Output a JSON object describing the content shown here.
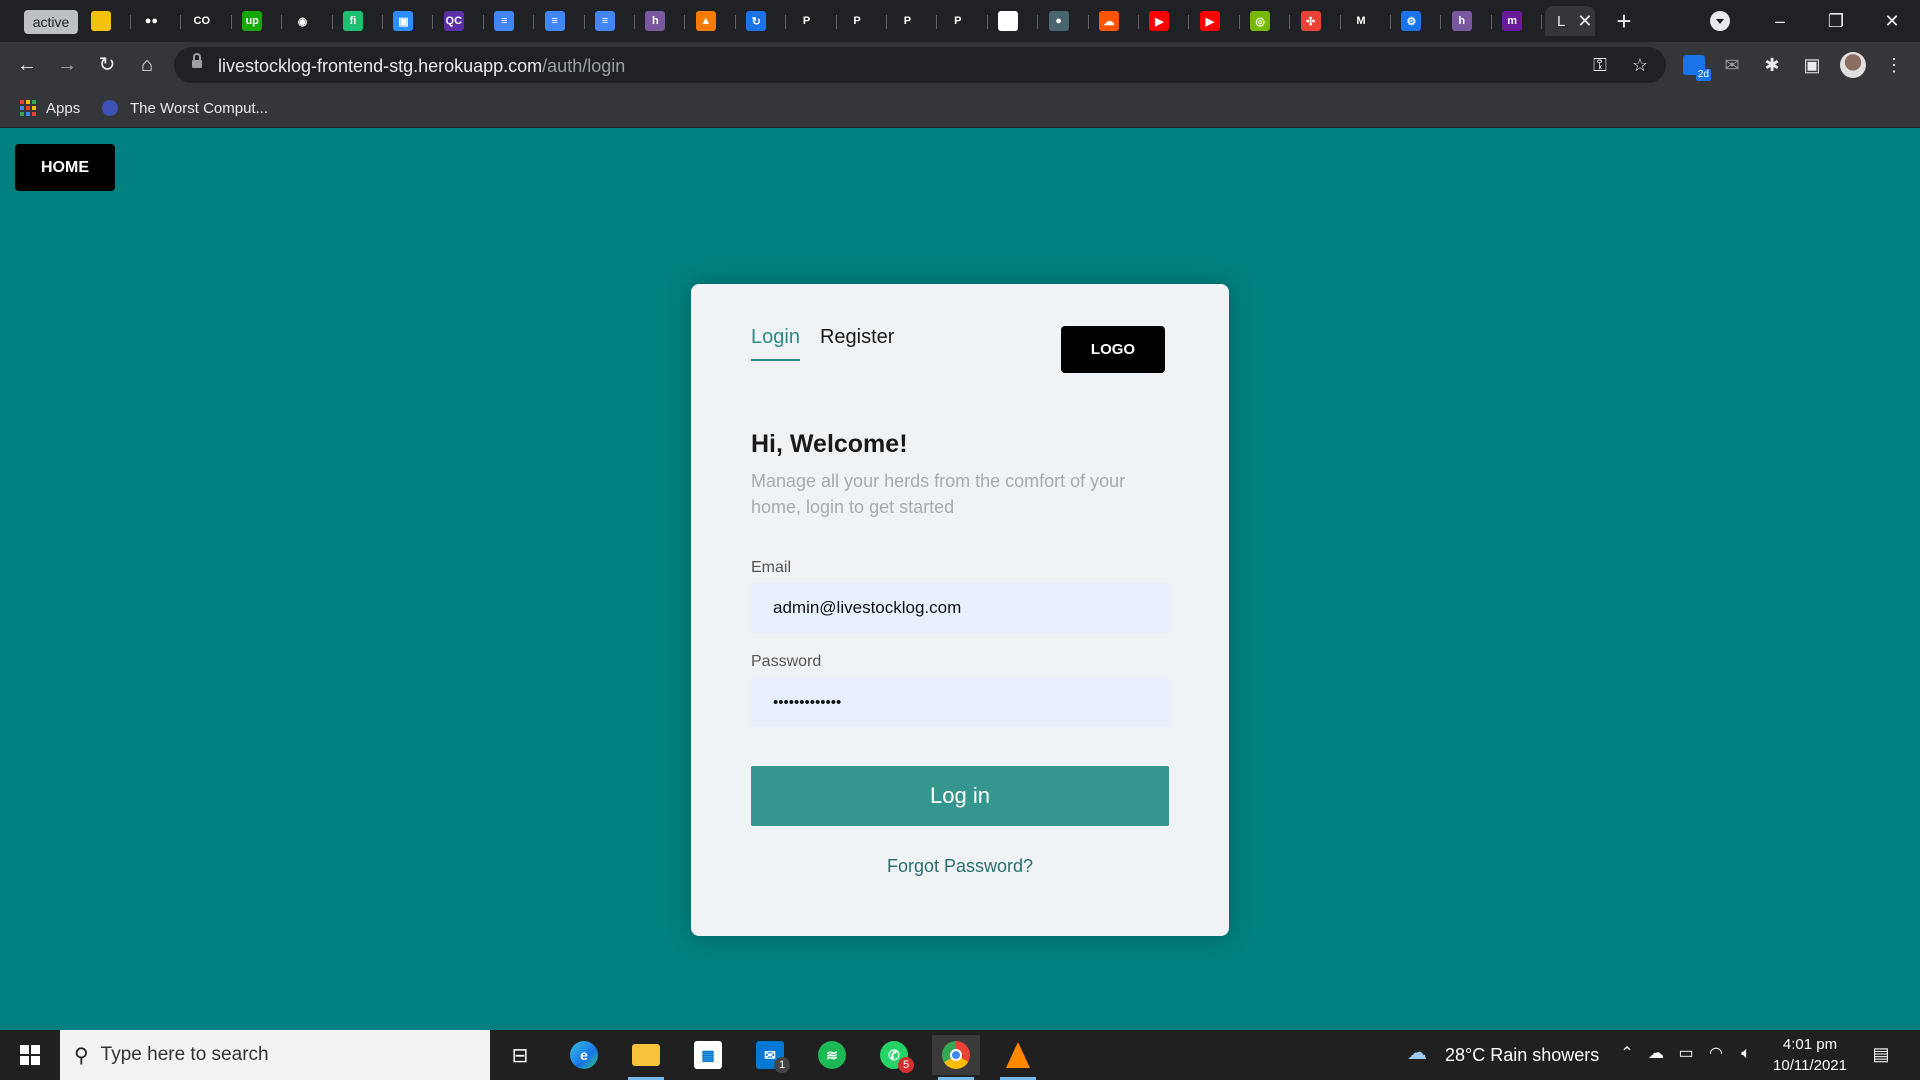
{
  "browser": {
    "active_tab_label": "active",
    "current_tab_title": "L",
    "tabs": [
      {
        "icon": "fhn-news-icon",
        "glyph": "",
        "color": "#f4c20d"
      },
      {
        "icon": "medium-icon",
        "glyph": "●●",
        "color": "#202124"
      },
      {
        "icon": "codepen-icon",
        "glyph": "CO",
        "color": "#202124"
      },
      {
        "icon": "upwork-icon",
        "glyph": "up",
        "color": "#14a800"
      },
      {
        "icon": "github-icon",
        "glyph": "◉",
        "color": "#202124"
      },
      {
        "icon": "fiverr-icon",
        "glyph": "fi",
        "color": "#1dbf73"
      },
      {
        "icon": "zoom-icon",
        "glyph": "▣",
        "color": "#2d8cff"
      },
      {
        "icon": "qc-icon",
        "glyph": "QC",
        "color": "#5b2ea6"
      },
      {
        "icon": "google-docs-icon",
        "glyph": "≡",
        "color": "#4285f4"
      },
      {
        "icon": "google-docs-icon",
        "glyph": "≡",
        "color": "#4285f4"
      },
      {
        "icon": "google-docs-icon",
        "glyph": "≡",
        "color": "#4285f4"
      },
      {
        "icon": "heroku-icon",
        "glyph": "h",
        "color": "#79589f"
      },
      {
        "icon": "orange-app-icon",
        "glyph": "▲",
        "color": "#f57c00"
      },
      {
        "icon": "refresh-app-icon",
        "glyph": "↻",
        "color": "#1a73e8"
      },
      {
        "icon": "paypal-icon",
        "glyph": "P",
        "color": "#202124"
      },
      {
        "icon": "paypal-icon",
        "glyph": "P",
        "color": "#202124"
      },
      {
        "icon": "paypal-icon",
        "glyph": "P",
        "color": "#202124"
      },
      {
        "icon": "paypal-icon",
        "glyph": "P",
        "color": "#202124"
      },
      {
        "icon": "play-icon",
        "glyph": "▶",
        "color": "#ffffff"
      },
      {
        "icon": "globe-icon",
        "glyph": "●",
        "color": "#4a6572"
      },
      {
        "icon": "soundcloud-icon",
        "glyph": "☁",
        "color": "#ff5500"
      },
      {
        "icon": "youtube-icon",
        "glyph": "▶",
        "color": "#ff0000"
      },
      {
        "icon": "youtube-icon",
        "glyph": "▶",
        "color": "#ff0000"
      },
      {
        "icon": "nvidia-icon",
        "glyph": "◎",
        "color": "#76b900"
      },
      {
        "icon": "pinwheel-icon",
        "glyph": "✣",
        "color": "#ea4335"
      },
      {
        "icon": "gmail-icon",
        "glyph": "M",
        "color": "#202124"
      },
      {
        "icon": "settings-icon",
        "glyph": "⚙",
        "color": "#1a73e8"
      },
      {
        "icon": "heroku-icon",
        "glyph": "h",
        "color": "#79589f"
      },
      {
        "icon": "m-app-icon",
        "glyph": "m",
        "color": "#6a1b9a"
      }
    ],
    "url_host": "livestocklog-frontend-stg.herokuapp.com",
    "url_path": "/auth/login",
    "bookmarks": [
      {
        "label": "Apps"
      },
      {
        "label": "The Worst Comput..."
      }
    ],
    "extension_badge": "2d"
  },
  "page": {
    "home_label": "HOME",
    "tabs": {
      "login": "Login",
      "register": "Register"
    },
    "logo_label": "LOGO",
    "heading": "Hi, Welcome!",
    "subtitle": "Manage all your herds from the comfort of your home, login to get started",
    "email_label": "Email",
    "email_value": "admin@livestocklog.com",
    "password_label": "Password",
    "password_value": "•••••••••••••",
    "login_button": "Log in",
    "forgot_link": "Forgot Password?",
    "colors": {
      "background": "#008080",
      "accent": "#35968f"
    }
  },
  "taskbar": {
    "search_placeholder": "Type here to search",
    "mail_badge": "1",
    "whatsapp_badge": "5",
    "weather": "28°C  Rain showers",
    "time": "4:01 pm",
    "date": "10/11/2021"
  }
}
